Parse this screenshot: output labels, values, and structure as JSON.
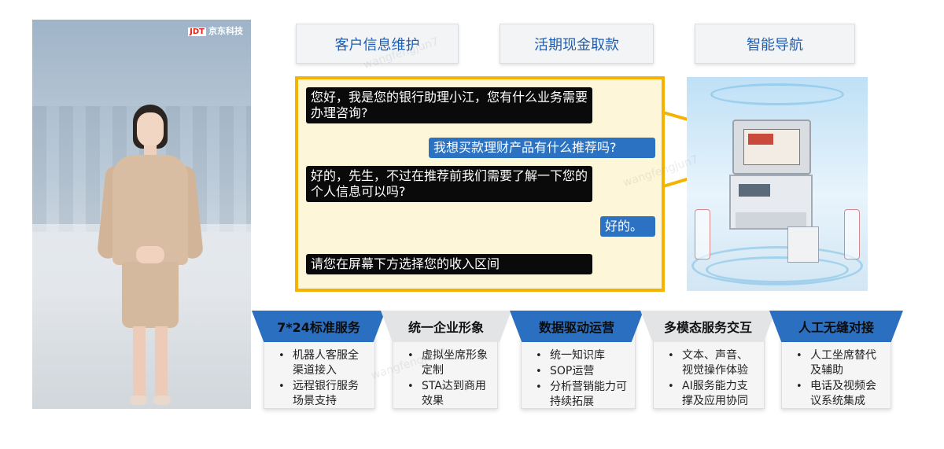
{
  "logo": {
    "mark": "JDT",
    "text": "京东科技"
  },
  "top_buttons": [
    {
      "label": "客户信息维护"
    },
    {
      "label": "活期现金取款"
    },
    {
      "label": "智能导航"
    }
  ],
  "chat": {
    "messages": [
      {
        "role": "assistant",
        "text": "您好，我是您的银行助理小江，您有什么业务需要办理咨询?"
      },
      {
        "role": "user",
        "text": "我想买款理财产品有什么推荐吗?"
      },
      {
        "role": "assistant",
        "text": "好的，先生，不过在推荐前我们需要了解一下您的个人信息可以吗?"
      },
      {
        "role": "user",
        "text": "好的。"
      },
      {
        "role": "assistant",
        "text": "请您在屏幕下方选择您的收入区间"
      }
    ]
  },
  "features": [
    {
      "title": "7*24标准服务",
      "items": [
        "机器人客服全渠道接入",
        "远程银行服务场景支持"
      ]
    },
    {
      "title": "统一企业形象",
      "items": [
        "虚拟坐席形象定制",
        "STA达到商用效果"
      ]
    },
    {
      "title": "数据驱动运营",
      "items": [
        "统一知识库",
        "SOP运营",
        "分析营销能力可持续拓展"
      ]
    },
    {
      "title": "多模态服务交互",
      "items": [
        "文本、声音、视觉操作体验",
        "AI服务能力支撑及应用协同"
      ]
    },
    {
      "title": "人工无缝对接",
      "items": [
        "人工坐席替代及辅助",
        "电话及视频会议系统集成"
      ]
    }
  ],
  "watermark": "wangfengjun7",
  "colors": {
    "accent_blue": "#2b6fc0",
    "chat_border": "#f4b300",
    "button_text": "#1f5fb3"
  }
}
